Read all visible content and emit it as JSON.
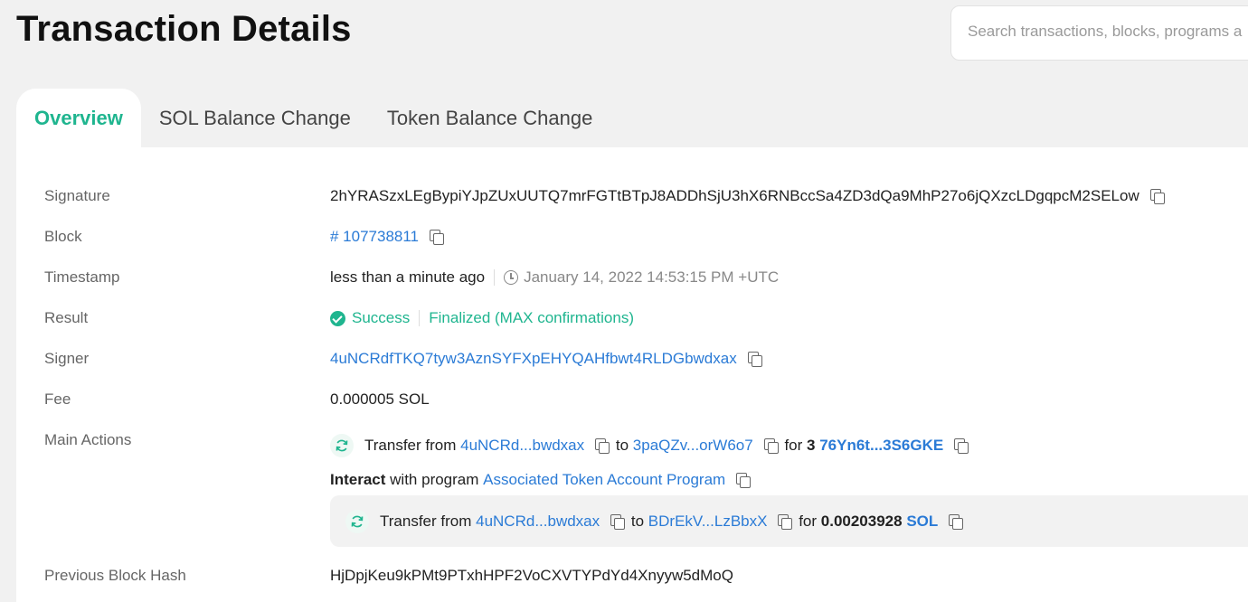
{
  "header": {
    "title": "Transaction Details",
    "search_placeholder": "Search transactions, blocks, programs a"
  },
  "tabs": [
    {
      "label": "Overview"
    },
    {
      "label": "SOL Balance Change"
    },
    {
      "label": "Token Balance Change"
    }
  ],
  "details": {
    "signature": {
      "label": "Signature",
      "value": "2hYRASzxLEgBypiYJpZUxUUTQ7mrFGTtBTpJ8ADDhSjU3hX6RNBccSa4ZD3dQa9MhP27o6jQXzcLDgqpcM2SELow"
    },
    "block": {
      "label": "Block",
      "value": "# 107738811"
    },
    "timestamp": {
      "label": "Timestamp",
      "relative": "less than a minute ago",
      "absolute": "January 14, 2022 14:53:15 PM +UTC"
    },
    "result": {
      "label": "Result",
      "status": "Success",
      "finality": "Finalized (MAX confirmations)"
    },
    "signer": {
      "label": "Signer",
      "value": "4uNCRdfTKQ7tyw3AznSYFXpEHYQAHfbwt4RLDGbwdxax"
    },
    "fee": {
      "label": "Fee",
      "value": "0.000005 SOL"
    },
    "main_actions": {
      "label": "Main Actions",
      "transfer1": {
        "prefix": "Transfer from",
        "from": "4uNCRd...bwdxax",
        "to_word": "to",
        "to": "3paQZv...orW6o7",
        "for_word": "for",
        "amount": "3",
        "token": "76Yn6t...3S6GKE"
      },
      "interact": {
        "bold": "Interact",
        "middle": "with program",
        "program": "Associated Token Account Program"
      },
      "transfer2": {
        "prefix": "Transfer from",
        "from": "4uNCRd...bwdxax",
        "to_word": "to",
        "to": "BDrEkV...LzBbxX",
        "for_word": "for",
        "amount": "0.00203928",
        "token": "SOL"
      }
    },
    "previous_block_hash": {
      "label": "Previous Block Hash",
      "value": "HjDpjKeu9kPMt9PTxhHPF2VoCXVTYPdYd4Xnyyw5dMoQ"
    }
  },
  "colors": {
    "accent": "#1fb58f",
    "link": "#2b7bd6"
  }
}
